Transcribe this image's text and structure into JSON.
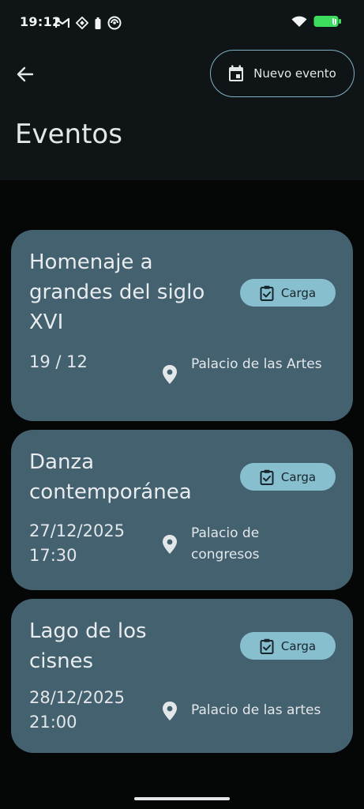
{
  "status_bar": {
    "time": "19:12"
  },
  "header": {
    "new_event_label": "Nuevo evento",
    "title": "Eventos"
  },
  "events": [
    {
      "title": "Homenaje a grandes del siglo XVI",
      "date": "19 / 12",
      "location": "Palacio de las Artes",
      "action_label": "Carga"
    },
    {
      "title": "Danza contemporánea",
      "date": "27/12/2025 17:30",
      "location": "Palacio de congresos",
      "action_label": "Carga"
    },
    {
      "title": "Lago de los cisnes",
      "date": "28/12/2025 21:00",
      "location": "Palacio de las artes",
      "action_label": "Carga"
    }
  ],
  "colors": {
    "card_background": "#44616f",
    "action_background": "#88bfcf",
    "outline_accent": "#7fb2c2",
    "battery_green": "#3ddc5f"
  },
  "icons": {
    "back": "arrow-back-icon",
    "calendar": "calendar-icon",
    "clipboard_check": "clipboard-check-icon",
    "location": "location-pin-icon"
  }
}
